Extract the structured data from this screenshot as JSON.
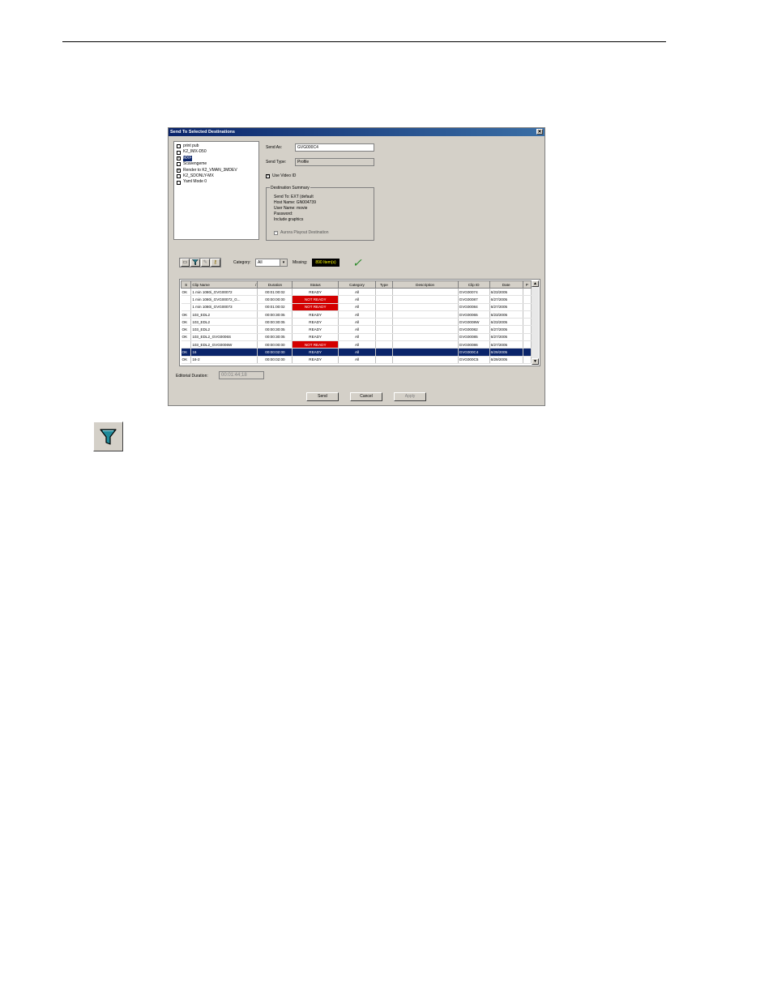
{
  "dialog": {
    "title": "Send To Selected Destinations",
    "close_glyph": "✕"
  },
  "destinations": [
    {
      "label": "print pub",
      "checked": false,
      "selected": false
    },
    {
      "label": "K2_IMX-D50",
      "checked": false,
      "selected": false
    },
    {
      "label": "MXF",
      "checked": true,
      "selected": true
    },
    {
      "label": "Scavengeme",
      "checked": false,
      "selected": false
    },
    {
      "label": "Render to K2_VMAN_3MDEV",
      "checked": true,
      "selected": false
    },
    {
      "label": "K2_SDONLY-MX",
      "checked": false,
      "selected": false
    },
    {
      "label": "Yaml Mode 0",
      "checked": false,
      "selected": false
    }
  ],
  "form": {
    "send_as_label": "Send As:",
    "send_as_value": "GVG000C4",
    "send_type_label": "Send Type:",
    "send_type_value": "Profile",
    "use_video_id_label": "Use Video ID",
    "use_video_id_checked": true
  },
  "summary": {
    "title": "Destination Summary",
    "lines": [
      "Send To: EXT (default",
      "Host Name: GN004739",
      "User Name: movie",
      "Password:",
      "Include graphics"
    ],
    "aurora_label": "Aurora Playout Destination"
  },
  "filter_bar": {
    "category_label": "Category:",
    "category_value": "All",
    "missing_label": "Missing:",
    "missing_value": "890 Item(s)"
  },
  "table": {
    "columns": [
      "S",
      "Clip Name",
      "Duration",
      "Status",
      "Category",
      "Type",
      "Description",
      "Clip ID",
      "Date",
      "P"
    ],
    "sort_indicator": "/",
    "rows": [
      [
        "OK",
        "1 min 1080i_GVG00072",
        "00:01:00:02",
        "READY",
        "All",
        "",
        "",
        "GVG00074",
        "6/23/2005",
        ""
      ],
      [
        "",
        "1 min 1080i_GVG00072_G...",
        "00:00:00:00",
        "NOT READY",
        "All",
        "",
        "",
        "GVG00087",
        "6/27/2005",
        ""
      ],
      [
        "",
        "1 min 1080i_GVG00073",
        "00:01:00:02",
        "NOT READY",
        "All",
        "",
        "",
        "GVG00084",
        "6/27/2005",
        ""
      ],
      [
        "OK",
        "103_EDL2",
        "00:00:30:05",
        "READY",
        "All",
        "",
        "",
        "GVG00065",
        "6/23/2005",
        ""
      ],
      [
        "OK",
        "103_EDL2",
        "00:00:30:05",
        "READY",
        "All",
        "",
        "",
        "GVG0008W",
        "6/23/2005",
        ""
      ],
      [
        "OK",
        "103_EDL2",
        "00:00:30:05",
        "READY",
        "All",
        "",
        "",
        "GVG00082",
        "6/27/2005",
        ""
      ],
      [
        "OK",
        "103_EDL2_GVG0006S",
        "00:00:30:05",
        "READY",
        "All",
        "",
        "",
        "GVG00085",
        "6/27/2005",
        ""
      ],
      [
        "",
        "103_EDL2_GVG0006W",
        "00:00:00:00",
        "NOT READY",
        "All",
        "",
        "",
        "GVG00086",
        "6/27/2005",
        ""
      ],
      [
        "OK",
        "16",
        "00:00:02:00",
        "READY",
        "All",
        "",
        "",
        "GVG000C4",
        "6/29/2005",
        ""
      ],
      [
        "OK",
        "16-2",
        "00:00:02:00",
        "READY",
        "All",
        "",
        "",
        "GVG000C5",
        "6/29/2005",
        ""
      ]
    ],
    "selected_row_index": 8
  },
  "editorial": {
    "label": "Editorial Duration:",
    "value": "00:01:44;18"
  },
  "buttons": {
    "send": "Send",
    "cancel": "Cancel",
    "apply": "Apply"
  },
  "icons": {
    "toolbar": [
      "window-icon",
      "filter-icon",
      "pencil-icon",
      "key-icon"
    ],
    "big": "filter-icon"
  },
  "colors": {
    "titlebar": "#0a246a",
    "not_ready": "#d40000",
    "selection": "#0a246a",
    "missing_text": "#ffff00"
  }
}
